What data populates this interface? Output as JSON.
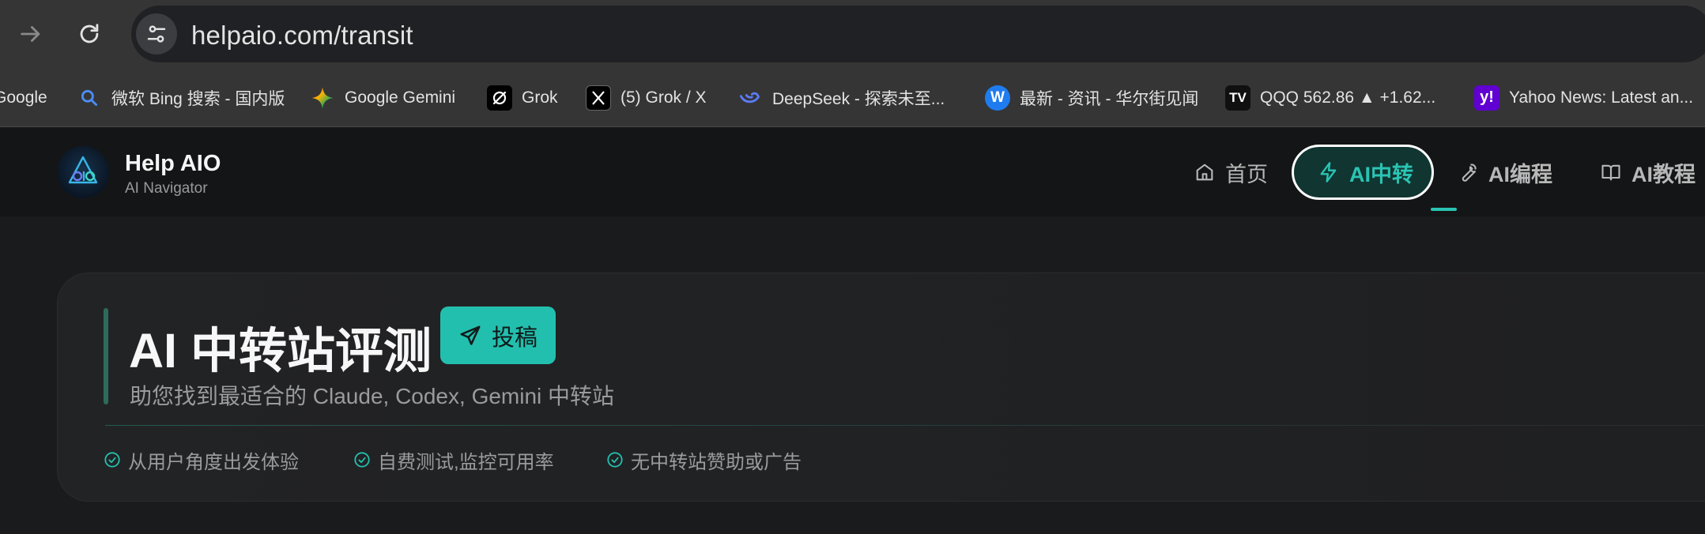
{
  "browser": {
    "url": "helpaio.com/transit",
    "bookmarks": [
      {
        "label": "Google",
        "icon": "google-icon"
      },
      {
        "label": "微软 Bing 搜索 - 国内版",
        "icon": "search-icon"
      },
      {
        "label": "Google Gemini",
        "icon": "gemini-icon"
      },
      {
        "label": "Grok",
        "icon": "grok-icon"
      },
      {
        "label": "(5) Grok / X",
        "icon": "x-icon"
      },
      {
        "label": "DeepSeek - 探索未至...",
        "icon": "deepseek-icon"
      },
      {
        "label": "最新 - 资讯 - 华尔街见闻",
        "icon": "wallstreetcn-icon"
      },
      {
        "label": "QQQ 562.86 ▲ +1.62...",
        "icon": "tradingview-icon"
      },
      {
        "label": "Yahoo News: Latest an...",
        "icon": "yahoo-icon"
      }
    ]
  },
  "header": {
    "brand_name": "Help AIO",
    "brand_sub": "AI Navigator",
    "nav": {
      "home": "首页",
      "transit": "AI中转",
      "coding": "AI编程",
      "tutorial": "AI教程"
    }
  },
  "hero": {
    "title": "AI 中转站评测",
    "submit_label": "投稿",
    "subtitle": "助您找到最适合的 Claude, Codex, Gemini 中转站",
    "features": [
      "从用户角度出发体验",
      "自费测试,监控可用率",
      "无中转站赞助或广告"
    ]
  },
  "colors": {
    "accent": "#23bfae",
    "background": "#1a1b1d",
    "chrome": "#353535"
  }
}
